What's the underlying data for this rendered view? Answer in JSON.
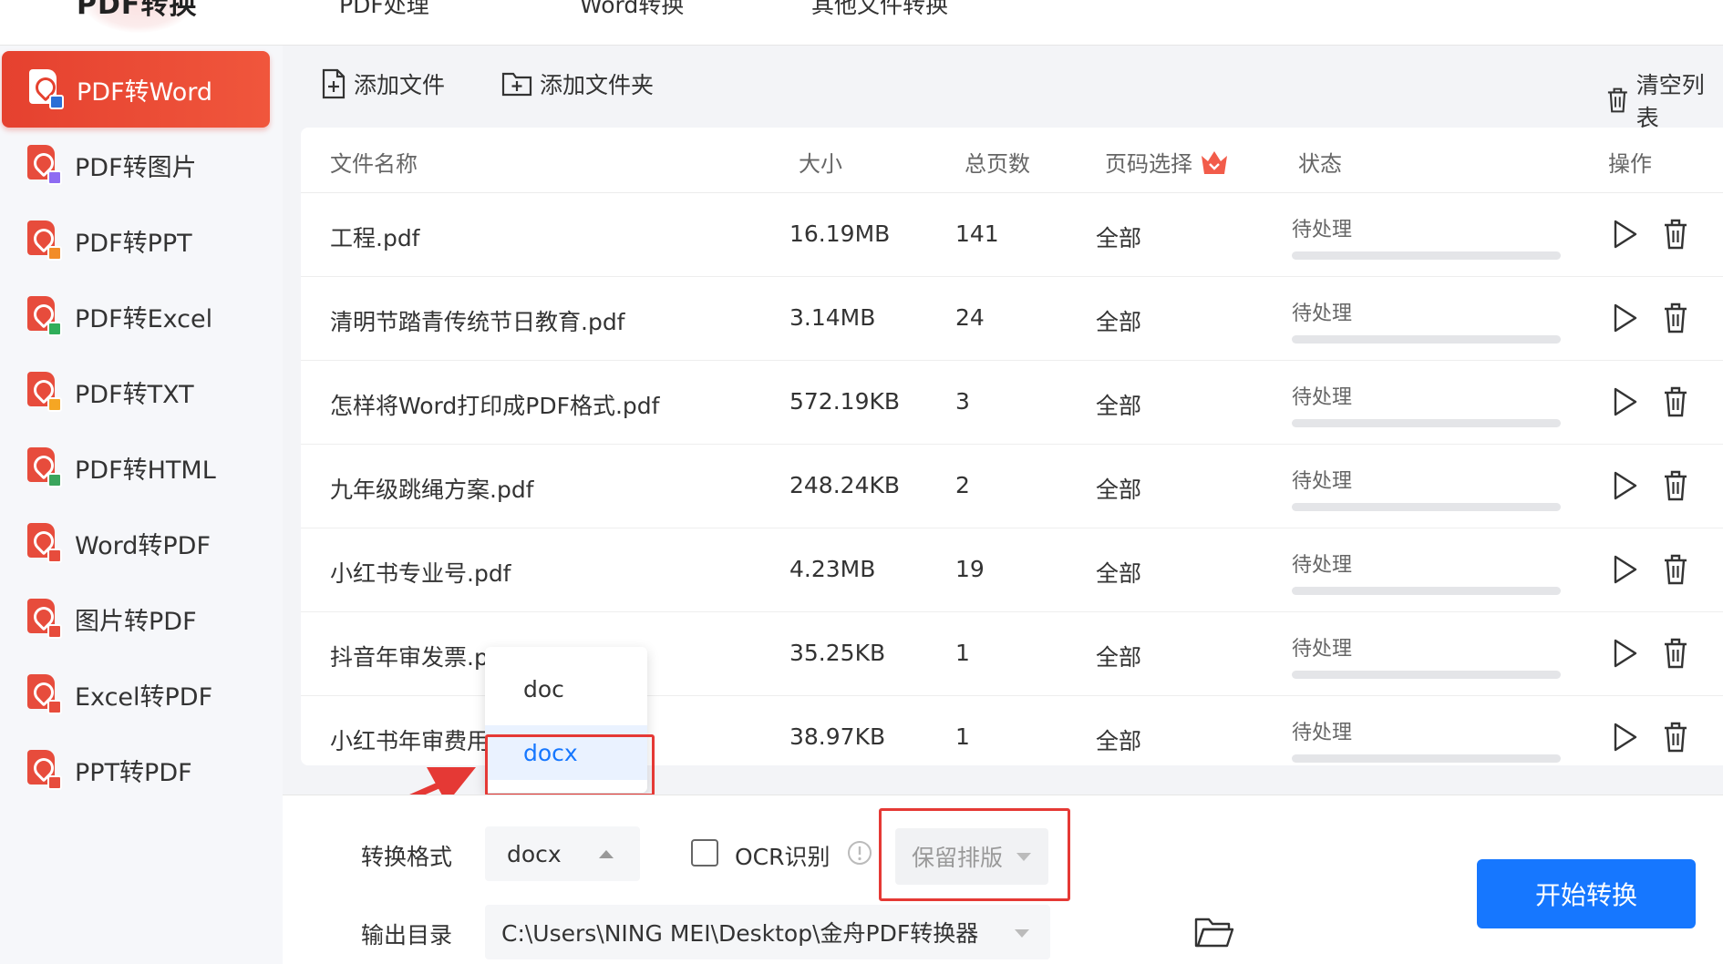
{
  "app": {
    "brand": "PDF转换"
  },
  "topnav": {
    "tabs": [
      "PDF处理",
      "Word转换",
      "其他文件转换"
    ]
  },
  "sidebar": {
    "items": [
      {
        "label": "PDF转Word",
        "badge": "#2b6fd6",
        "active": true
      },
      {
        "label": "PDF转图片",
        "badge": "#8e6bf2",
        "active": false
      },
      {
        "label": "PDF转PPT",
        "badge": "#f28c28",
        "active": false
      },
      {
        "label": "PDF转Excel",
        "badge": "#2fae5a",
        "active": false
      },
      {
        "label": "PDF转TXT",
        "badge": "#f5a623",
        "active": false
      },
      {
        "label": "PDF转HTML",
        "badge": "#3aa55c",
        "active": false
      },
      {
        "label": "Word转PDF",
        "badge": "#e74c3c",
        "active": false
      },
      {
        "label": "图片转PDF",
        "badge": "#e74c3c",
        "active": false
      },
      {
        "label": "Excel转PDF",
        "badge": "#e74c3c",
        "active": false
      },
      {
        "label": "PPT转PDF",
        "badge": "#e74c3c",
        "active": false
      }
    ]
  },
  "toolbar": {
    "add_file": "添加文件",
    "add_folder": "添加文件夹",
    "clear_list": "清空列表"
  },
  "table": {
    "headers": {
      "name": "文件名称",
      "size": "大小",
      "pages": "总页数",
      "page_select": "页码选择",
      "status": "状态",
      "action": "操作"
    },
    "rows": [
      {
        "name": "工程.pdf",
        "size": "16.19MB",
        "pages": "141",
        "page_select": "全部",
        "status": "待处理",
        "progress": 0
      },
      {
        "name": "清明节踏青传统节日教育.pdf",
        "size": "3.14MB",
        "pages": "24",
        "page_select": "全部",
        "status": "待处理",
        "progress": 0
      },
      {
        "name": "怎样将Word打印成PDF格式.pdf",
        "size": "572.19KB",
        "pages": "3",
        "page_select": "全部",
        "status": "待处理",
        "progress": 0
      },
      {
        "name": "九年级跳绳方案.pdf",
        "size": "248.24KB",
        "pages": "2",
        "page_select": "全部",
        "status": "待处理",
        "progress": 0
      },
      {
        "name": "小红书专业号.pdf",
        "size": "4.23MB",
        "pages": "19",
        "page_select": "全部",
        "status": "待处理",
        "progress": 0
      },
      {
        "name": "抖音年审发票.p",
        "size": "35.25KB",
        "pages": "1",
        "page_select": "全部",
        "status": "待处理",
        "progress": 0
      },
      {
        "name": "小红书年审费用",
        "size": "38.97KB",
        "pages": "1",
        "page_select": "全部",
        "status": "待处理",
        "progress": 0
      }
    ]
  },
  "format_popup": {
    "options": [
      "doc",
      "docx"
    ],
    "selected": "docx"
  },
  "bottom": {
    "format_label": "转换格式",
    "format_value": "docx",
    "ocr_label": "OCR识别",
    "ocr_checked": false,
    "layout_value": "保留排版",
    "output_label": "输出目录",
    "output_path": "C:\\Users\\NING MEI\\Desktop\\金舟PDF转换器",
    "start_button": "开始转换"
  },
  "colors": {
    "accent_red": "#e5412f",
    "primary_blue": "#1677ff",
    "annotation_red": "#e53935"
  }
}
